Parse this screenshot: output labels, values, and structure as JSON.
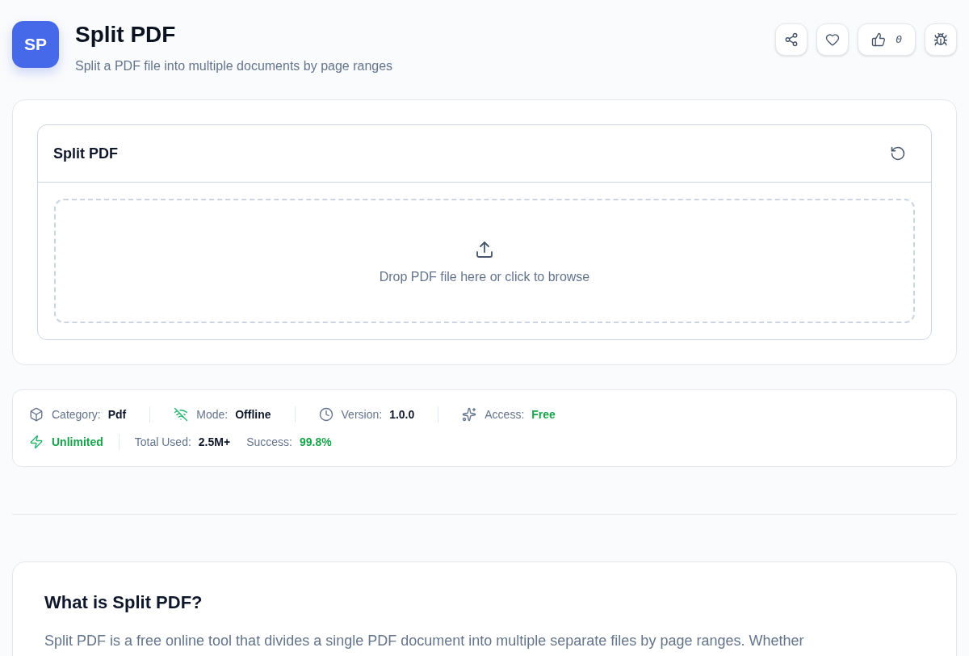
{
  "header": {
    "logo": "SP",
    "title": "Split PDF",
    "subtitle": "Split a PDF file into multiple documents by page ranges"
  },
  "actions": [
    {
      "kind": "share"
    },
    {
      "kind": "favorite"
    },
    {
      "kind": "like",
      "count": "0"
    },
    {
      "kind": "report"
    }
  ],
  "tool": {
    "title": "Split PDF",
    "dropzone": {
      "text": "Drop PDF file here or click to browse"
    }
  },
  "info": {
    "rows": [
      [
        [
          {
            "kind": "category",
            "label": "Category:",
            "value": "Pdf",
            "color": "#0f172a"
          }
        ],
        [
          {
            "kind": "mode",
            "label": "Mode:",
            "value": "Offline",
            "color": "#0f172a"
          }
        ],
        [
          {
            "kind": "version",
            "label": "Version:",
            "value": "1.0.0",
            "color": "#0f172a"
          }
        ],
        [
          {
            "kind": "access",
            "label": "Access:",
            "value": "Free",
            "color": "#16a34a"
          }
        ]
      ],
      [
        [
          {
            "kind": "limit",
            "label": "Unlimited",
            "color": "#16a34a"
          }
        ],
        [
          {
            "kind": "total",
            "label": "Total Used:",
            "value": "2.5M+",
            "color": "#0f172a"
          },
          {
            "kind": "success",
            "label": "Success:",
            "value": "99.8%",
            "color": "#16a34a"
          }
        ]
      ]
    ]
  },
  "about": {
    "title": "What is Split PDF?",
    "text": "Split PDF is a free online tool that divides a single PDF document into multiple separate files by page ranges. Whether"
  }
}
